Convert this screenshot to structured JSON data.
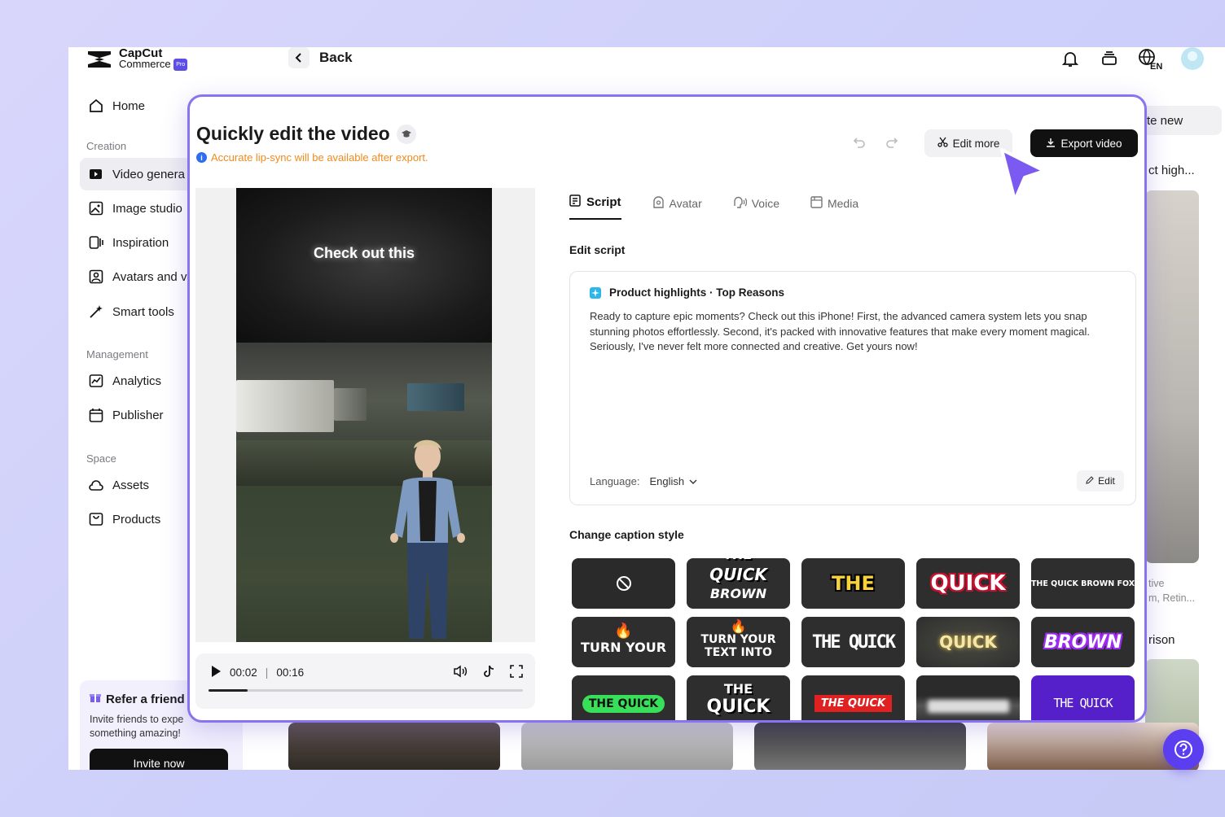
{
  "header": {
    "logo_line1": "CapCut",
    "logo_line2": "Commerce",
    "logo_badge": "Pro",
    "back_label": "Back",
    "lang_code": "EN"
  },
  "sidebar": {
    "home": "Home",
    "section_creation": "Creation",
    "items_creation": [
      "Video genera",
      "Image studio",
      "Inspiration",
      "Avatars and v",
      "Smart tools"
    ],
    "section_management": "Management",
    "items_management": [
      "Analytics",
      "Publisher"
    ],
    "section_space": "Space",
    "items_space": [
      "Assets",
      "Products"
    ],
    "refer_title": "Refer a friend",
    "refer_text": "Invite friends to expe something amazing!",
    "invite_label": "Invite now"
  },
  "background": {
    "create_new": "te new",
    "product_high": "ct high...",
    "tive": "tive",
    "retin": "m, Retin...",
    "rison": "rison"
  },
  "modal": {
    "title": "Quickly edit the video",
    "lip_note": "Accurate lip-sync will be available after export.",
    "edit_more": "Edit more",
    "export": "Export video",
    "video_caption": "Check out this",
    "time_current": "00:02",
    "time_total": "00:16",
    "progress": 0.125,
    "tabs": [
      "Script",
      "Avatar",
      "Voice",
      "Media"
    ],
    "edit_script_label": "Edit script",
    "script_header": "Product highlights · Top Reasons",
    "script_body": "Ready to capture epic moments? Check out this iPhone! First, the advanced camera system lets you snap stunning photos effortlessly. Second, it's packed with innovative features that make every moment magical. Seriously, I've never felt more connected and creative. Get yours now!",
    "language_label": "Language:",
    "language_value": "English",
    "edit_label": "Edit",
    "caption_label": "Change caption style",
    "caption_styles": [
      "",
      "QUICK",
      "THE",
      "QUICK",
      "THE QUICK BROWN FOX",
      "TURN YOUR",
      "TURN YOUR TEXT INTO",
      "THE QUICK",
      "QUICK",
      "BROWN",
      "THE QUICK",
      "QUICK",
      "THE QUICK",
      "",
      "THE QUICK"
    ]
  },
  "colors": {
    "accent": "#8a73f0",
    "help": "#5a3ef0",
    "warning": "#f08a1c"
  }
}
